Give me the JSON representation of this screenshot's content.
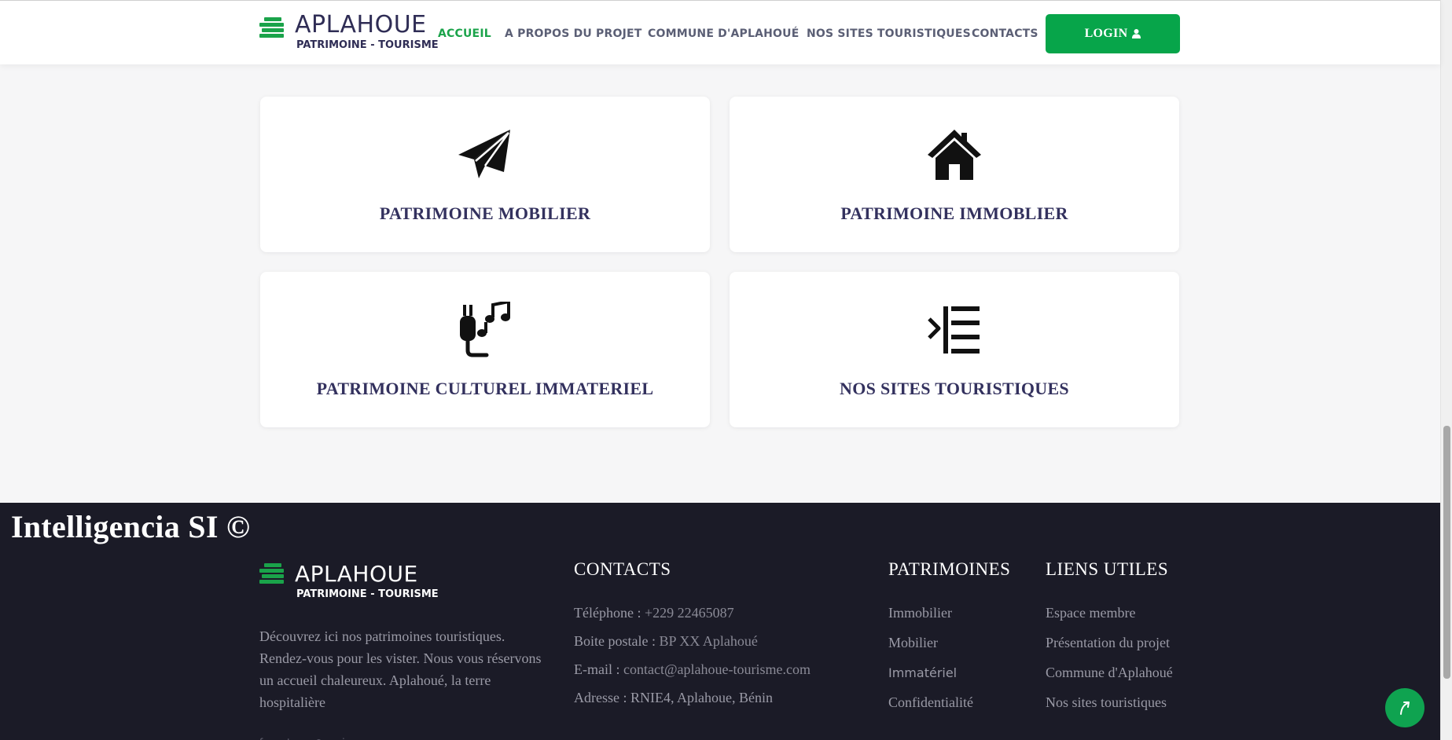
{
  "brand": {
    "title": "APLAHOUE",
    "subtitle": "PATRIMOINE - TOURISME",
    "accent_color": "#1aa34a"
  },
  "nav": {
    "items": [
      {
        "label": "ACCUEIL",
        "active": true
      },
      {
        "label": "A PROPOS DU PROJET",
        "active": false
      },
      {
        "label": "COMMUNE D'APLAHOUÉ",
        "active": false
      },
      {
        "label": "NOS SITES TOURISTIQUES",
        "active": false
      },
      {
        "label": "CONTACTS",
        "active": false
      }
    ],
    "login_label": "LOGIN",
    "login_icon": "user-icon"
  },
  "cards": [
    {
      "title": "PATRIMOINE MOBILIER",
      "icon": "paper-plane-icon"
    },
    {
      "title": "PATRIMOINE IMMOBLIER",
      "icon": "house-icon"
    },
    {
      "title": "PATRIMOINE CULTUREL IMMATERIEL",
      "icon": "music-cable-icon"
    },
    {
      "title": "NOS SITES TOURISTIQUES",
      "icon": "indent-list-icon"
    }
  ],
  "footer": {
    "copyright": "Intelligencia SI ©",
    "description": "Découvrez ici nos patrimoines touristiques. Rendez-vous pour les vister. Nous vous réservons un accueil chaleureux. Aplahoué, la terre hospitalière",
    "contacts": {
      "heading": "CONTACTS",
      "phone_label": "Téléphone : ",
      "phone": "+229 22465087",
      "box_label": "Boite postale : ",
      "box": "BP XX Aplahoué",
      "email_label": "E-mail : ",
      "email": "contact@aplahoue-tourisme.com",
      "address": "Adresse : RNIE4, Aplahoue, Bénin"
    },
    "patrimoines": {
      "heading": "PATRIMOINES",
      "links": [
        "Immobilier",
        "Mobilier",
        "Immatériel",
        "Confidentialité"
      ]
    },
    "liens": {
      "heading": "LIENS UTILES",
      "links": [
        "Espace membre",
        "Présentation du projet",
        "Commune d'Aplahoué",
        "Nos sites touristiques"
      ]
    },
    "socials": [
      "facebook-icon",
      "twitter-icon",
      "instagram-icon",
      "linkedin-icon"
    ]
  }
}
